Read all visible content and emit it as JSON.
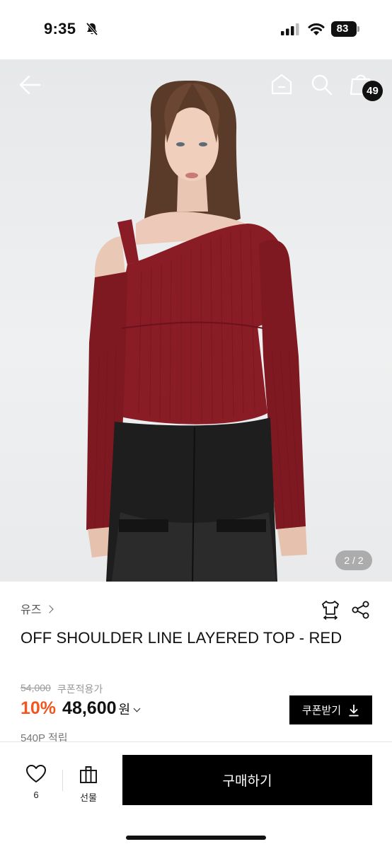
{
  "status_bar": {
    "time": "9:35",
    "battery": "83",
    "icons": [
      "bell-slash-icon",
      "signal-icon",
      "wifi-icon",
      "battery-icon"
    ]
  },
  "top_nav": {
    "icons": [
      "back-arrow-icon",
      "home-icon",
      "search-icon",
      "shopping-bag-icon"
    ],
    "cart_count": "49"
  },
  "gallery": {
    "page_indicator": "2 / 2",
    "current": 2,
    "total": 2,
    "colors": {
      "top": "#8a1c26",
      "pants": "#1e1e1e",
      "background": "#eceef0"
    }
  },
  "product": {
    "brand": "유즈",
    "title": "OFF SHOULDER LINE LAYERED TOP - RED",
    "original_price": "54,000",
    "coupon_note": "쿠폰적용가",
    "discount": "10%",
    "price": "48,600",
    "currency": "원",
    "points": "540P 적립",
    "icons": [
      "size-guide-icon",
      "share-icon",
      "chevron-right-icon",
      "chevron-down-icon"
    ]
  },
  "coupon_button": {
    "label": "쿠폰받기",
    "icon": "download-icon"
  },
  "bottom_bar": {
    "like_count": "6",
    "gift_label": "선물",
    "buy_label": "구매하기",
    "icons": [
      "heart-icon",
      "gift-icon"
    ]
  },
  "colors": {
    "accent": "#f0561f",
    "primary_button": "#000000",
    "badge": "#111111"
  }
}
